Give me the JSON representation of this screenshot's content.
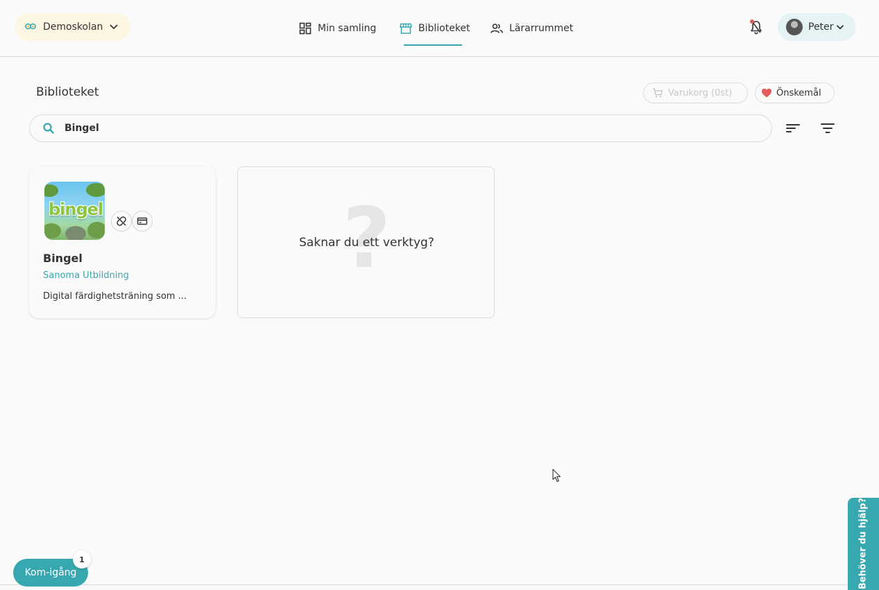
{
  "header": {
    "school": "Demoskolan",
    "nav": [
      {
        "label": "Min samling",
        "icon": "grid-icon"
      },
      {
        "label": "Biblioteket",
        "icon": "store-icon",
        "active": true
      },
      {
        "label": "Lärarrummet",
        "icon": "people-icon"
      }
    ],
    "user": "Peter"
  },
  "page": {
    "title": "Biblioteket",
    "cart_label": "Varukorg (0st)",
    "wishlist_label": "Önskemål"
  },
  "search": {
    "value": "Bingel"
  },
  "products": [
    {
      "title": "Bingel",
      "thumb_word": "bingel",
      "vendor": "Sanoma Utbildning",
      "description": "Digital färdighetsträning som ..."
    }
  ],
  "missing_tool": {
    "text": "Saknar du ett verktyg?"
  },
  "footer": {
    "start_label": "Kom-igång",
    "start_count": "1",
    "help_label": "Behöver du hjälp?"
  },
  "colors": {
    "accent": "#37a8b0",
    "school_bg": "#fdf6e3",
    "user_bg": "#e5f3f4",
    "heart": "#e45b5b"
  }
}
